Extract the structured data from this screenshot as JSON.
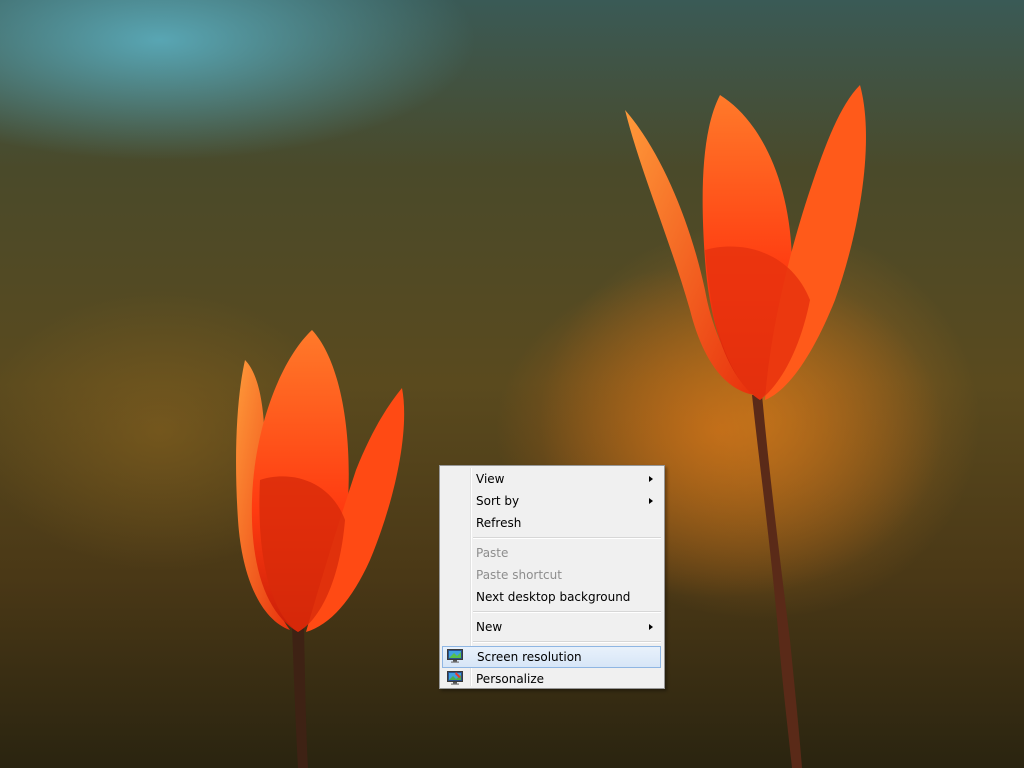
{
  "desktop": {
    "wallpaper_icon": "tulips-wallpaper"
  },
  "context_menu": {
    "items": [
      {
        "label": "View",
        "submenu": true,
        "enabled": true
      },
      {
        "label": "Sort by",
        "submenu": true,
        "enabled": true
      },
      {
        "label": "Refresh",
        "submenu": false,
        "enabled": true
      },
      {
        "label": "Paste",
        "submenu": false,
        "enabled": false
      },
      {
        "label": "Paste shortcut",
        "submenu": false,
        "enabled": false
      },
      {
        "label": "Next desktop background",
        "submenu": false,
        "enabled": true
      },
      {
        "label": "New",
        "submenu": true,
        "enabled": true
      },
      {
        "label": "Screen resolution",
        "submenu": false,
        "enabled": true,
        "selected": true,
        "icon": "monitor-icon"
      },
      {
        "label": "Personalize",
        "submenu": false,
        "enabled": true,
        "icon": "personalize-icon"
      }
    ]
  },
  "colors": {
    "menu_background": "#f0f0f0",
    "highlight_border": "#8fb6e3",
    "disabled_text": "#8d8d8d",
    "tulip": "#ff4a12"
  }
}
